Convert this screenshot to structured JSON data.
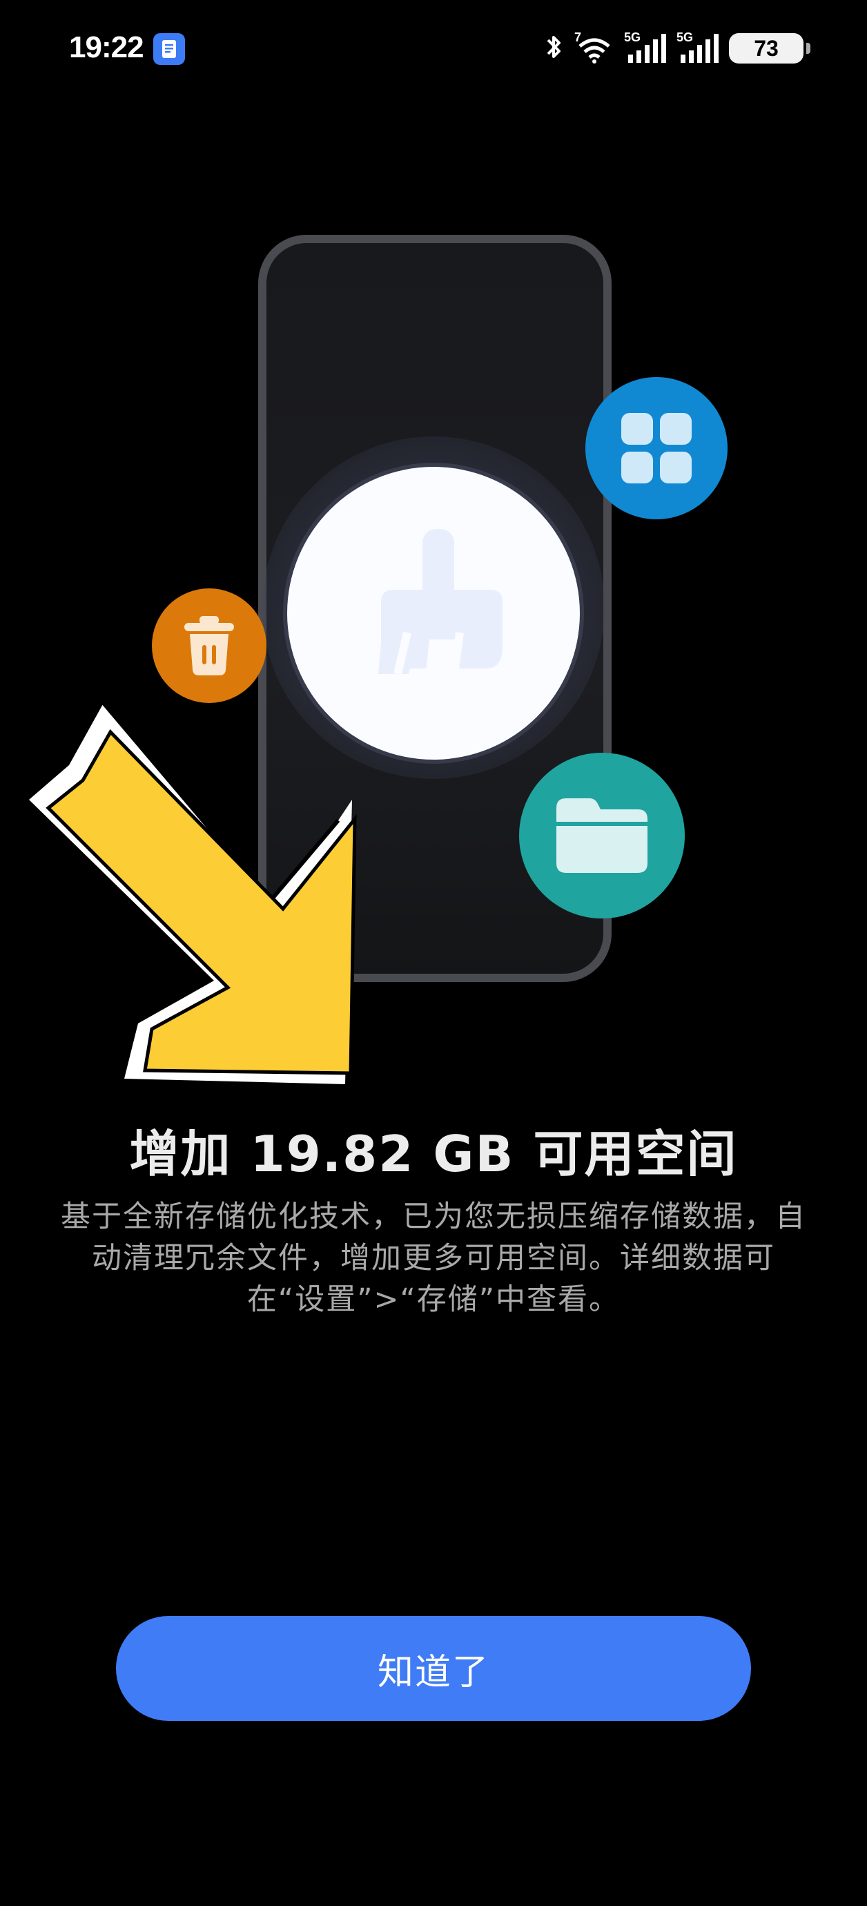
{
  "status_bar": {
    "time": "19:22",
    "wifi_label": "7",
    "signal1_label": "5G",
    "signal2_label": "5G",
    "battery": "73"
  },
  "illustration": {
    "center_icon": "broom-icon",
    "bubbles": [
      {
        "icon": "apps-grid-icon",
        "color": "#1189d2"
      },
      {
        "icon": "trash-icon",
        "color": "#db7a0a"
      },
      {
        "icon": "folder-icon",
        "color": "#1fa4a0"
      }
    ],
    "arrow_color": "#fccd34"
  },
  "content": {
    "headline": "增加 19.82 GB 可用空间",
    "description": "基于全新存储优化技术，已为您无损压缩存储数据，自动清理冗余文件，增加更多可用空间。详细数据可在“设置”>“存储”中查看。"
  },
  "actions": {
    "ok_label": "知道了",
    "accent_color": "#3f7cf6"
  }
}
